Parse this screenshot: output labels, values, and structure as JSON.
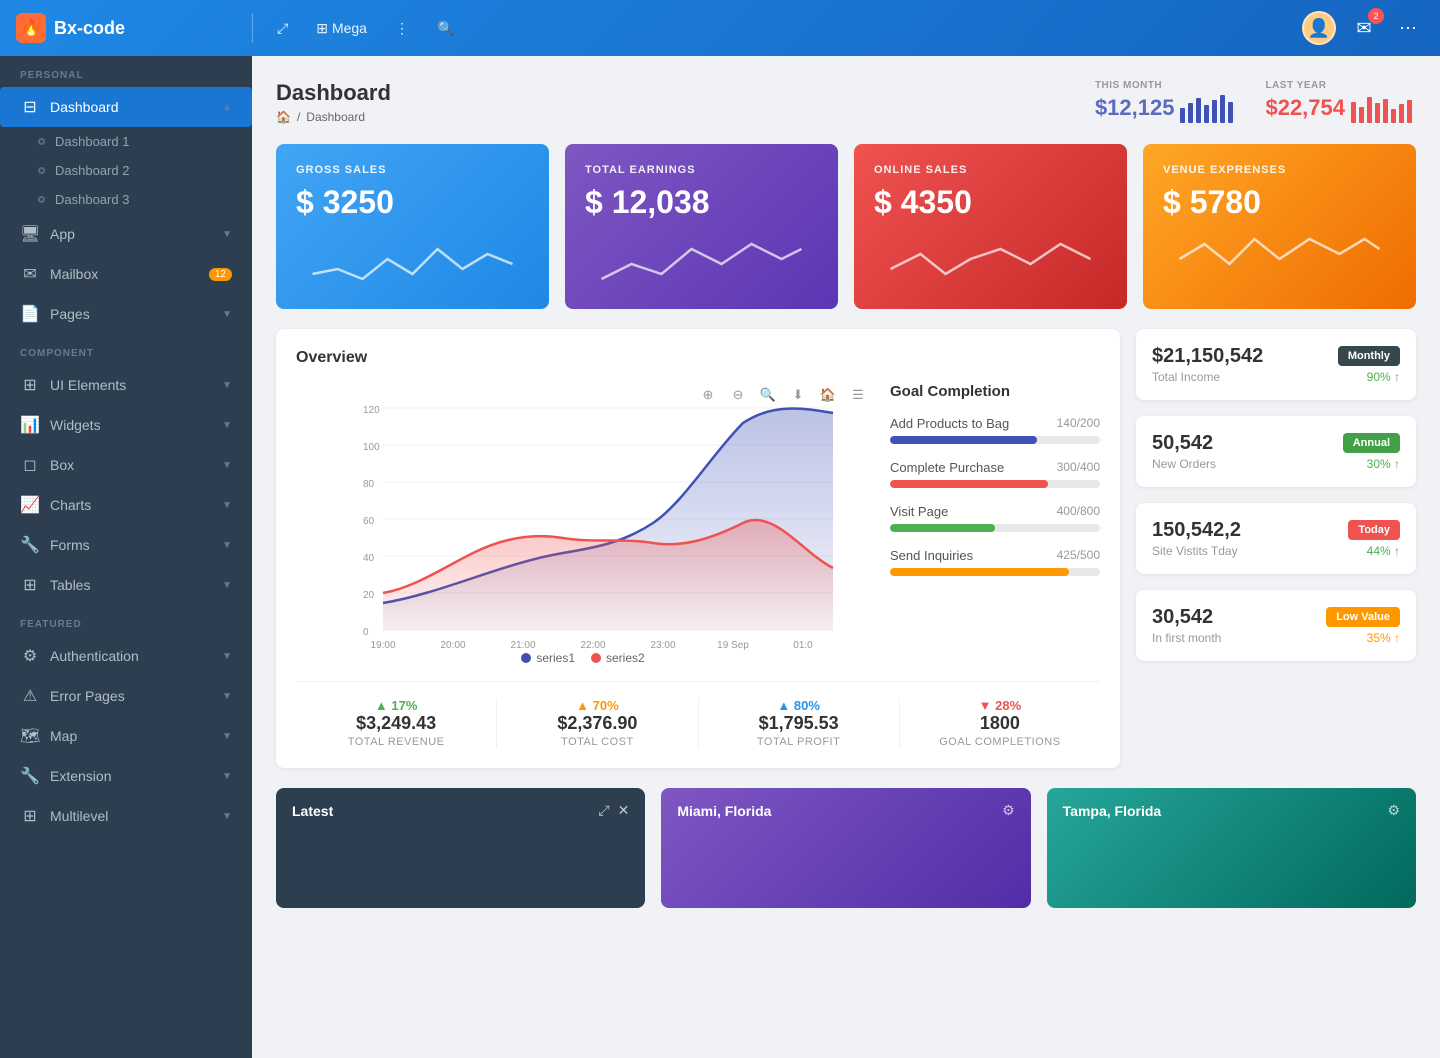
{
  "app": {
    "brand": "Bx-code",
    "brand_icon": "🔥"
  },
  "topnav": {
    "items": [
      {
        "label": "Mega",
        "icon": "⊞"
      },
      {
        "label": "⋮",
        "icon": "⋮"
      },
      {
        "label": "🔍",
        "icon": "🔍"
      }
    ],
    "badge_count": "2"
  },
  "sidebar": {
    "personal_label": "PERSONAL",
    "component_label": "COMPONENT",
    "featured_label": "FEATURED",
    "items": [
      {
        "id": "dashboard",
        "label": "Dashboard",
        "icon": "⊟",
        "active": true,
        "arrow": "▲"
      },
      {
        "id": "dashboard1",
        "label": "Dashboard 1",
        "sub": true
      },
      {
        "id": "dashboard2",
        "label": "Dashboard 2",
        "sub": true
      },
      {
        "id": "dashboard3",
        "label": "Dashboard 3",
        "sub": true
      },
      {
        "id": "app",
        "label": "App",
        "icon": "🖥",
        "arrow": "▼"
      },
      {
        "id": "mailbox",
        "label": "Mailbox",
        "icon": "✉",
        "badge": "12"
      },
      {
        "id": "pages",
        "label": "Pages",
        "icon": "📄",
        "arrow": "▼"
      },
      {
        "id": "ui-elements",
        "label": "UI Elements",
        "icon": "⊞",
        "arrow": "▼"
      },
      {
        "id": "widgets",
        "label": "Widgets",
        "icon": "📊",
        "arrow": "▼"
      },
      {
        "id": "box",
        "label": "Box",
        "icon": "◻",
        "arrow": "▼"
      },
      {
        "id": "charts",
        "label": "Charts",
        "icon": "📈",
        "arrow": "▼"
      },
      {
        "id": "forms",
        "label": "Forms",
        "icon": "🔧",
        "arrow": "▼"
      },
      {
        "id": "tables",
        "label": "Tables",
        "icon": "⊞",
        "arrow": "▼"
      },
      {
        "id": "authentication",
        "label": "Authentication",
        "icon": "⚙",
        "arrow": "▼"
      },
      {
        "id": "error-pages",
        "label": "Error Pages",
        "icon": "⚠",
        "arrow": "▼"
      },
      {
        "id": "map",
        "label": "Map",
        "icon": "🗺",
        "arrow": "▼"
      },
      {
        "id": "extension",
        "label": "Extension",
        "icon": "🔧",
        "arrow": "▼"
      },
      {
        "id": "multilevel",
        "label": "Multilevel",
        "icon": "⊞",
        "arrow": "▼"
      }
    ]
  },
  "page": {
    "title": "Dashboard",
    "breadcrumb_home": "🏠",
    "breadcrumb_current": "Dashboard"
  },
  "header_stats": {
    "this_month_label": "THIS MONTH",
    "this_month_value": "$12,125",
    "last_year_label": "LAST YEAR",
    "last_year_value": "$22,754",
    "this_month_bars": [
      30,
      50,
      70,
      45,
      65,
      80,
      55
    ],
    "last_year_bars": [
      60,
      45,
      80,
      55,
      70,
      40,
      65,
      50
    ]
  },
  "metric_cards": [
    {
      "id": "gross-sales",
      "label": "GROSS SALES",
      "value": "$ 3250",
      "color": "blue"
    },
    {
      "id": "total-earnings",
      "label": "TOTAL EARNINGS",
      "value": "$ 12,038",
      "color": "purple"
    },
    {
      "id": "online-sales",
      "label": "ONLINE SALES",
      "value": "$ 4350",
      "color": "red"
    },
    {
      "id": "venue-expenses",
      "label": "VENUE EXPRENSES",
      "value": "$ 5780",
      "color": "orange"
    }
  ],
  "overview": {
    "title": "Overview",
    "chart_times": [
      "19:00",
      "20:00",
      "21:00",
      "22:00",
      "23:00",
      "19 Sep",
      "01:0"
    ],
    "y_axis": [
      120,
      100,
      80,
      60,
      40,
      20,
      0
    ],
    "legend": [
      {
        "label": "series1",
        "color": "#3f51b5"
      },
      {
        "label": "series2",
        "color": "#ef5350"
      }
    ],
    "goal_completion": {
      "title": "Goal Completion",
      "items": [
        {
          "label": "Add Products to Bag",
          "current": 140,
          "total": 200,
          "color": "#3f51b5"
        },
        {
          "label": "Complete Purchase",
          "current": 300,
          "total": 400,
          "color": "#ef5350"
        },
        {
          "label": "Visit Page",
          "current": 400,
          "total": 800,
          "color": "#4caf50"
        },
        {
          "label": "Send Inquiries",
          "current": 425,
          "total": 500,
          "color": "#ff9800"
        }
      ]
    }
  },
  "stat_metrics": [
    {
      "pct": "▲ 17%",
      "pct_color": "green",
      "value": "$3,249.43",
      "label": "TOTAL REVENUE"
    },
    {
      "pct": "▲ 70%",
      "pct_color": "orange",
      "value": "$2,376.90",
      "label": "TOTAL COST"
    },
    {
      "pct": "▲ 80%",
      "pct_color": "blue",
      "value": "$1,795.53",
      "label": "TOTAL PROFIT"
    },
    {
      "pct": "▼ 28%",
      "pct_color": "red",
      "value": "1800",
      "label": "GOAL COMPLETIONS"
    }
  ],
  "right_panel": [
    {
      "amount": "$21,150,542",
      "label": "Total Income",
      "badge": "Monthly",
      "badge_color": "dark",
      "pct": "90% ↑",
      "pct_color": "green"
    },
    {
      "amount": "50,542",
      "label": "New Orders",
      "badge": "Annual",
      "badge_color": "green",
      "pct": "30% ↑",
      "pct_color": "green"
    },
    {
      "amount": "150,542,2",
      "label": "Site Vistits Tday",
      "badge": "Today",
      "badge_color": "red",
      "pct": "44% ↑",
      "pct_color": "green"
    },
    {
      "amount": "30,542",
      "label": "In first month",
      "badge": "Low Value",
      "badge_color": "orange",
      "pct": "35% ↑",
      "pct_color": "orange"
    }
  ],
  "bottom_cards": [
    {
      "title": "Latest",
      "type": "dark-img",
      "icons": [
        "⤢",
        "✕"
      ]
    },
    {
      "title": "Miami, Florida",
      "type": "purple-card",
      "icons": [
        "⚙"
      ]
    },
    {
      "title": "Tampa, Florida",
      "type": "teal-card",
      "icons": [
        "⚙"
      ]
    }
  ]
}
